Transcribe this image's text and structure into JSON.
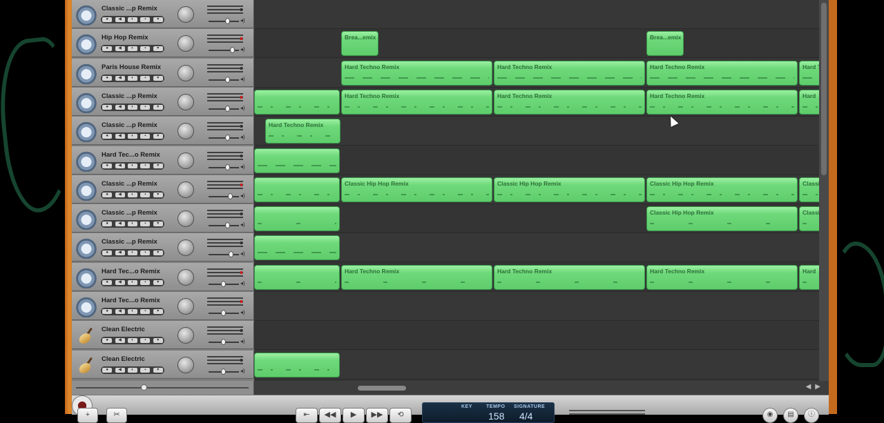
{
  "tracks": [
    {
      "name": "Classic ...p Remix",
      "icon": "drum-kit-icon",
      "vol": 0.62,
      "armed": false
    },
    {
      "name": "Hip Hop Remix",
      "icon": "drum-kit-icon",
      "vol": 0.78,
      "armed": true
    },
    {
      "name": "Paris House Remix",
      "icon": "drum-kit-icon",
      "vol": 0.62,
      "armed": false
    },
    {
      "name": "Classic ...p Remix",
      "icon": "drum-kit-icon",
      "vol": 0.62,
      "armed": true
    },
    {
      "name": "Classic ...p Remix",
      "icon": "drum-kit-icon",
      "vol": 0.62,
      "armed": false
    },
    {
      "name": "Hard Tec...o Remix",
      "icon": "drum-kit-icon",
      "vol": 0.62,
      "armed": false
    },
    {
      "name": "Classic ...p Remix",
      "icon": "drum-kit-icon",
      "vol": 0.7,
      "armed": true
    },
    {
      "name": "Classic ...p Remix",
      "icon": "drum-kit-icon",
      "vol": 0.62,
      "armed": false
    },
    {
      "name": "Classic ...p Remix",
      "icon": "drum-kit-icon",
      "vol": 0.72,
      "armed": false
    },
    {
      "name": "Hard Tec...o Remix",
      "icon": "drum-kit-icon",
      "vol": 0.48,
      "armed": true
    },
    {
      "name": "Hard Tec...o Remix",
      "icon": "drum-kit-icon",
      "vol": 0.48,
      "armed": true
    },
    {
      "name": "Clean Electric",
      "icon": "guitar-icon",
      "vol": 0.48,
      "armed": false
    },
    {
      "name": "Clean Electric",
      "icon": "guitar-icon",
      "vol": 0.48,
      "armed": false
    }
  ],
  "regions": [
    {
      "lane": 1,
      "start": 126,
      "len": 54,
      "label": "Brea...emix",
      "notes": "none"
    },
    {
      "lane": 1,
      "start": 568,
      "len": 54,
      "label": "Brea...emix",
      "notes": "none"
    },
    {
      "lane": 2,
      "start": 126,
      "len": 219,
      "label": "Hard Techno Remix",
      "notes": "long"
    },
    {
      "lane": 2,
      "start": 347,
      "len": 219,
      "label": "Hard Techno Remix",
      "notes": "long"
    },
    {
      "lane": 2,
      "start": 568,
      "len": 219,
      "label": "Hard Techno Remix",
      "notes": "long"
    },
    {
      "lane": 2,
      "start": 789,
      "len": 40,
      "label": "Hard T",
      "notes": "long"
    },
    {
      "lane": 3,
      "start": 0,
      "len": 124,
      "label": "",
      "notes": "dense"
    },
    {
      "lane": 3,
      "start": 126,
      "len": 219,
      "label": "Hard Techno Remix",
      "notes": "dense"
    },
    {
      "lane": 3,
      "start": 347,
      "len": 219,
      "label": "Hard Techno Remix",
      "notes": "dense"
    },
    {
      "lane": 3,
      "start": 568,
      "len": 219,
      "label": "Hard Techno Remix",
      "notes": "dense"
    },
    {
      "lane": 3,
      "start": 789,
      "len": 40,
      "label": "Hard",
      "notes": "dense"
    },
    {
      "lane": 4,
      "start": 16,
      "len": 109,
      "label": "Hard Techno Remix",
      "notes": "dense"
    },
    {
      "lane": 5,
      "start": 0,
      "len": 124,
      "label": "",
      "notes": "long"
    },
    {
      "lane": 6,
      "start": 0,
      "len": 124,
      "label": "",
      "notes": "dense"
    },
    {
      "lane": 6,
      "start": 126,
      "len": 219,
      "label": "Classic Hip Hop Remix",
      "notes": "dense"
    },
    {
      "lane": 6,
      "start": 347,
      "len": 219,
      "label": "Classic Hip Hop Remix",
      "notes": "dense"
    },
    {
      "lane": 6,
      "start": 568,
      "len": 219,
      "label": "Classic Hip Hop Remix",
      "notes": "dense"
    },
    {
      "lane": 6,
      "start": 789,
      "len": 40,
      "label": "Classic",
      "notes": "dense"
    },
    {
      "lane": 7,
      "start": 0,
      "len": 124,
      "label": "",
      "notes": "sparse"
    },
    {
      "lane": 7,
      "start": 568,
      "len": 219,
      "label": "Classic Hip Hop Remix",
      "notes": "sparse"
    },
    {
      "lane": 7,
      "start": 789,
      "len": 40,
      "label": "Classic",
      "notes": "sparse"
    },
    {
      "lane": 8,
      "start": 0,
      "len": 124,
      "label": "",
      "notes": "long"
    },
    {
      "lane": 9,
      "start": 0,
      "len": 124,
      "label": "",
      "notes": "sparse"
    },
    {
      "lane": 9,
      "start": 126,
      "len": 219,
      "label": "Hard Techno Remix",
      "notes": "sparse"
    },
    {
      "lane": 9,
      "start": 347,
      "len": 219,
      "label": "Hard Techno Remix",
      "notes": "sparse"
    },
    {
      "lane": 9,
      "start": 568,
      "len": 219,
      "label": "Hard Techno Remix",
      "notes": "sparse"
    },
    {
      "lane": 9,
      "start": 789,
      "len": 40,
      "label": "Hard",
      "notes": "sparse"
    },
    {
      "lane": 12,
      "start": 0,
      "len": 124,
      "label": "",
      "notes": "dense"
    }
  ],
  "lcd": {
    "key_label": "KEY",
    "tempo_label": "TEMPO",
    "signature_label": "SIGNATURE",
    "tempo_value": "158",
    "signature_value": "4/4"
  },
  "transport": {
    "add_track": "+",
    "scissors": "✂",
    "rewind_start": "⇤",
    "rewind": "◀◀",
    "play": "▶",
    "forward": "▶▶",
    "cycle": "⟲"
  },
  "colors": {
    "region_green": "#6ed97a",
    "frame_orange": "#d07a25",
    "lcd_blue": "#0d1c2b"
  }
}
